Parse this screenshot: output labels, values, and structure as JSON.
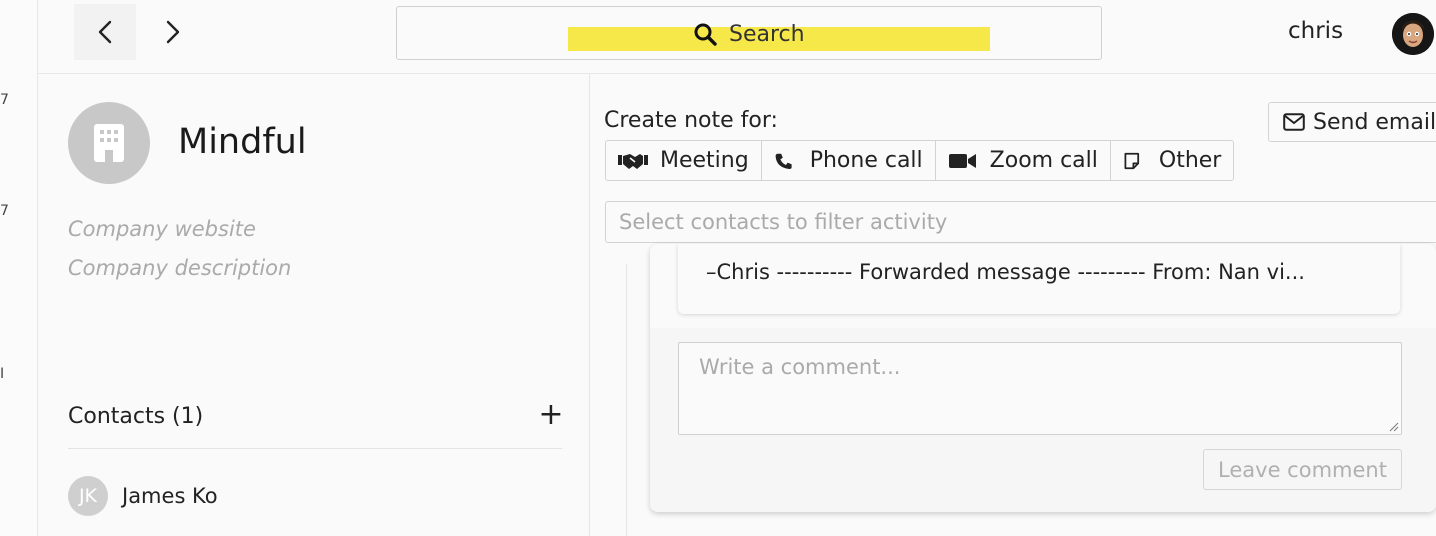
{
  "sidebar_fragments": [
    "7",
    "7",
    "I"
  ],
  "topbar": {
    "search_label": "Search",
    "user_name": "chris"
  },
  "company": {
    "name": "Mindful",
    "website_placeholder": "Company website",
    "description_placeholder": "Company description"
  },
  "contacts": {
    "header": "Contacts (1)",
    "add_symbol": "+",
    "items": [
      {
        "initials": "JK",
        "name": "James Ko"
      }
    ]
  },
  "notes": {
    "create_label": "Create note for:",
    "send_email_label": "Send email",
    "types": [
      {
        "label": "Meeting",
        "icon": "handshake-icon"
      },
      {
        "label": "Phone call",
        "icon": "phone-icon"
      },
      {
        "label": "Zoom call",
        "icon": "video-camera-icon"
      },
      {
        "label": "Other",
        "icon": "sticky-note-icon"
      }
    ],
    "filter_placeholder": "Select contacts to filter activity"
  },
  "activity": {
    "message_preview": "–Chris ---------- Forwarded message --------- From: Nan vi...",
    "comment_placeholder": "Write a comment...",
    "leave_comment_label": "Leave comment"
  },
  "colors": {
    "search_highlight": "#f7e84a",
    "placeholder_text": "#aaaaaa",
    "border": "#d3d3d3"
  }
}
